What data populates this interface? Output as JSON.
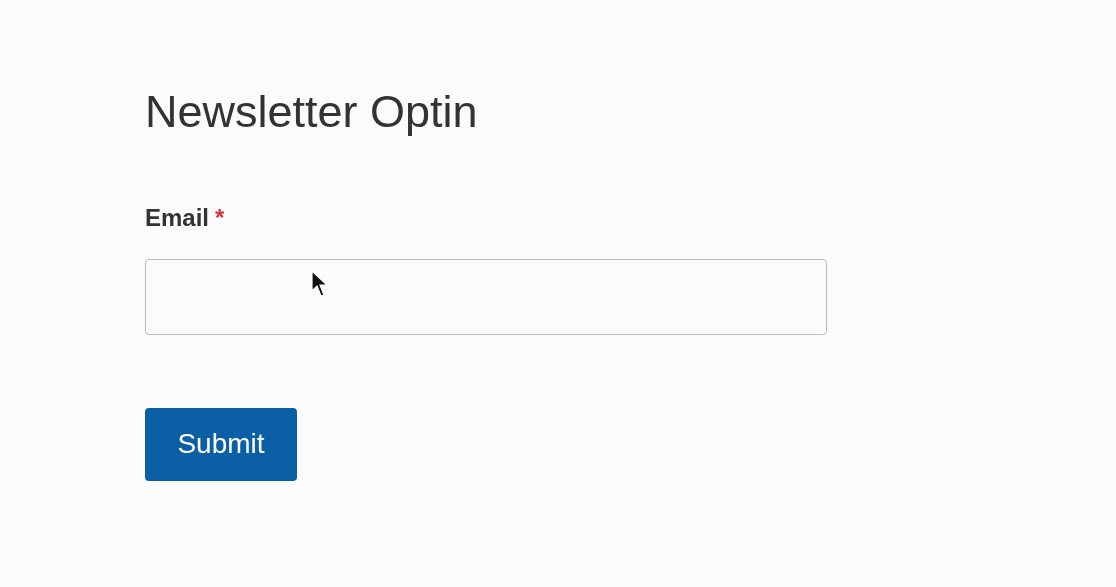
{
  "form": {
    "title": "Newsletter Optin",
    "fields": [
      {
        "label": "Email",
        "required": true,
        "required_mark": "*"
      }
    ],
    "submit": "Submit"
  },
  "cursor": {
    "kind": "pointer"
  }
}
